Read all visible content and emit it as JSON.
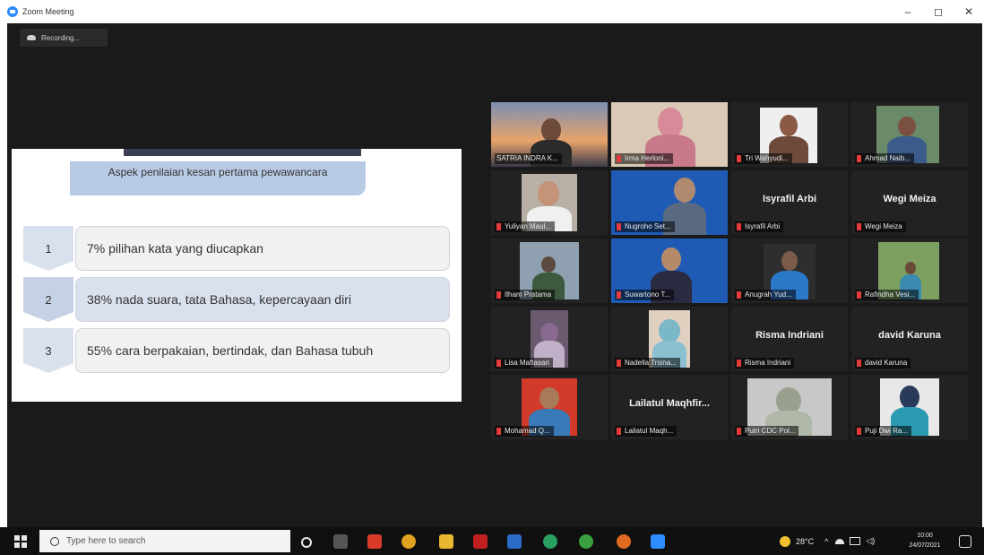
{
  "window": {
    "title": "Zoom Meeting",
    "controls": [
      "–",
      "◻",
      "✕"
    ]
  },
  "recording": {
    "label": "Recording..."
  },
  "slide": {
    "heading": "Aspek penilaian kesan pertama pewawancara",
    "items": [
      {
        "num": "1",
        "text": "7% pilihan kata yang diucapkan"
      },
      {
        "num": "2",
        "text": "38% nada suara, tata Bahasa, kepercayaan diri"
      },
      {
        "num": "3",
        "text": "55% cara berpakaian, bertindak, dan Bahasa tubuh"
      }
    ]
  },
  "participants": [
    {
      "label": "SATRIA INDRA K...",
      "active": true,
      "muted": false
    },
    {
      "label": "Irma Herloni...",
      "muted": true
    },
    {
      "label": "Tri Wahyudi...",
      "muted": true
    },
    {
      "label": "Ahmad Naib...",
      "muted": true
    },
    {
      "label": "Yuliyan Maul...",
      "muted": true
    },
    {
      "label": "Nugroho Set...",
      "muted": true
    },
    {
      "label": "Isyrafil Arbi",
      "name": "Isyrafil Arbi",
      "muted": true
    },
    {
      "label": "Wegi Meiza",
      "name": "Wegi Meiza",
      "muted": true
    },
    {
      "label": "Ilham Pratama",
      "muted": true
    },
    {
      "label": "Suwartono T...",
      "muted": true
    },
    {
      "label": "Anugrah Yud...",
      "muted": true
    },
    {
      "label": "Rafindha Vesi...",
      "muted": true
    },
    {
      "label": "Lisa Maftasari",
      "muted": true
    },
    {
      "label": "Nadella Trisna...",
      "muted": true
    },
    {
      "label": "Risma Indriani",
      "name": "Risma Indriani",
      "muted": true
    },
    {
      "label": "david Karuna",
      "name": "david Karuna",
      "muted": true
    },
    {
      "label": "Mohamad Q...",
      "muted": true
    },
    {
      "label": "Lailatul Maqh...",
      "name": "Lailatul Maqhfir...",
      "muted": true
    },
    {
      "label": "Putri CDC Pol...",
      "muted": true
    },
    {
      "label": "Puji Dwi Ra...",
      "muted": true
    }
  ],
  "taskbar": {
    "search_placeholder": "Type here to search",
    "weather": "28°C",
    "time": "10:00",
    "date": "24/07/2021"
  },
  "colors": {
    "accent": "#2d8cff",
    "active_border": "#c8d64a",
    "muted": "#e23b3b"
  }
}
